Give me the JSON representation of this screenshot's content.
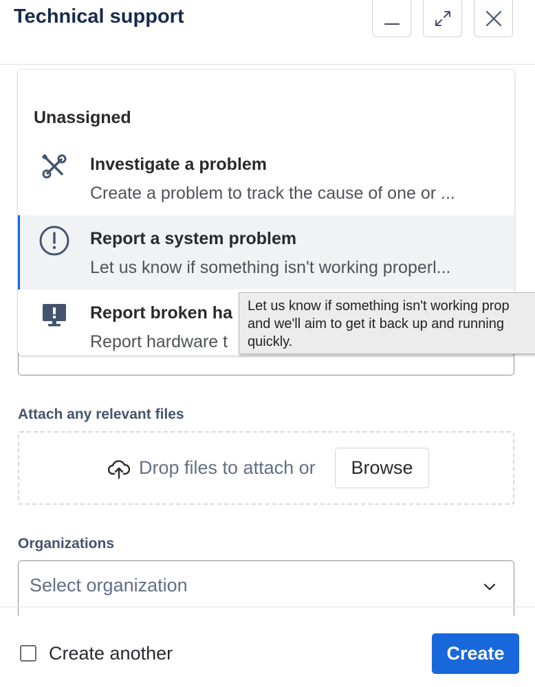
{
  "header": {
    "title": "Technical support",
    "buttons": [
      {
        "name": "minimize",
        "icon": "minimize-icon"
      },
      {
        "name": "expand",
        "icon": "expand-icon"
      },
      {
        "name": "close",
        "icon": "close-icon"
      }
    ]
  },
  "dropdown": {
    "group_heading": "Unassigned",
    "options": [
      {
        "title": "Investigate a problem",
        "description": "Create a problem to track the cause of one or ...",
        "icon": "tools-icon",
        "selected": false
      },
      {
        "title": "Report a system problem",
        "description": "Let us know if something isn't working properl...",
        "icon": "exclamation-circle-icon",
        "selected": true
      },
      {
        "title": "Report broken ha",
        "description": "Report hardware t",
        "icon": "monitor-alert-icon",
        "selected": false
      }
    ]
  },
  "tooltip": {
    "lines": [
      "Let us know if something isn't working prop",
      "and we'll aim to get it back up and running",
      "quickly."
    ]
  },
  "attachments": {
    "label": "Attach any relevant files",
    "drop_text": "Drop files to attach or",
    "browse_label": "Browse",
    "icon": "upload-cloud-icon"
  },
  "organizations": {
    "label": "Organizations",
    "placeholder": "Select organization"
  },
  "footer": {
    "create_another_label": "Create another",
    "create_another_checked": false,
    "create_label": "Create"
  },
  "colors": {
    "accent": "#1868db",
    "selected_bg": "#f1f2f4",
    "tooltip_bg": "#ececec"
  }
}
